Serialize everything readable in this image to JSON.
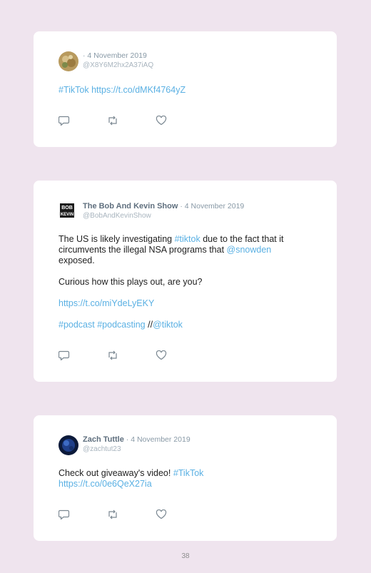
{
  "tweets": [
    {
      "name": "",
      "separator": "·",
      "date": "4 November 2019",
      "handle": "@X8Y6M2hx2A37iAQ",
      "body": {
        "link1": "#TikTok",
        "space": " ",
        "link2": "https://t.co/dMKf4764yZ"
      }
    },
    {
      "name": "The Bob And Kevin Show",
      "separator": "·",
      "date": "4 November 2019",
      "handle": "@BobAndKevinShow",
      "avatar_text": "BOB\nKEVIN",
      "body": {
        "p1_a": "The US is likely investigating ",
        "p1_link1": "#tiktok",
        "p1_b": " due to the fact that it circumvents the illegal NSA programs that ",
        "p1_link2": "@snowden",
        "p1_c": " exposed.",
        "p2": "Curious how this plays out, are you?",
        "p3_link": "https://t.co/miYdeLyEKY",
        "p4_link1": "#podcast",
        "p4_space": " ",
        "p4_link2": "#podcasting",
        "p4_sep": " //",
        "p4_link3": "@tiktok"
      }
    },
    {
      "name": "Zach Tuttle",
      "separator": "·",
      "date": "4 November 2019",
      "handle": "@zachtut23",
      "body": {
        "a": "Check out giveaway's video! ",
        "link1": "#TikTok",
        "link2": "https://t.co/0e6QeX27ia"
      }
    }
  ],
  "icons": [
    "reply-icon",
    "retweet-icon",
    "like-icon"
  ],
  "colors": {
    "background": "#efe4ee",
    "link": "#5ab0e3",
    "card": "#ffffff"
  },
  "page_number": "38"
}
